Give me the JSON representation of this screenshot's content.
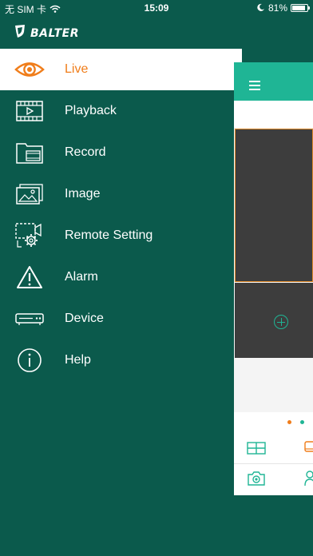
{
  "status_bar": {
    "carrier": "无 SIM 卡",
    "time": "15:09",
    "battery": "81%",
    "icons": [
      "wifi-icon",
      "moon-icon",
      "battery-icon"
    ]
  },
  "brand": {
    "name": "BALTER",
    "logo": "shield-logo"
  },
  "menu": {
    "items": [
      {
        "label": "Live",
        "icon": "eye-icon",
        "active": true
      },
      {
        "label": "Playback",
        "icon": "film-play-icon",
        "active": false
      },
      {
        "label": "Record",
        "icon": "folder-video-icon",
        "active": false
      },
      {
        "label": "Image",
        "icon": "image-icon",
        "active": false
      },
      {
        "label": "Remote Setting",
        "icon": "remote-gear-icon",
        "active": false
      },
      {
        "label": "Alarm",
        "icon": "alert-triangle-icon",
        "active": false
      },
      {
        "label": "Device",
        "icon": "dvr-device-icon",
        "active": false
      },
      {
        "label": "Help",
        "icon": "info-icon",
        "active": false
      }
    ]
  },
  "colors": {
    "sidebar_bg": "#0b5a4c",
    "accent_orange": "#f07d1a",
    "accent_teal": "#1fb595"
  }
}
